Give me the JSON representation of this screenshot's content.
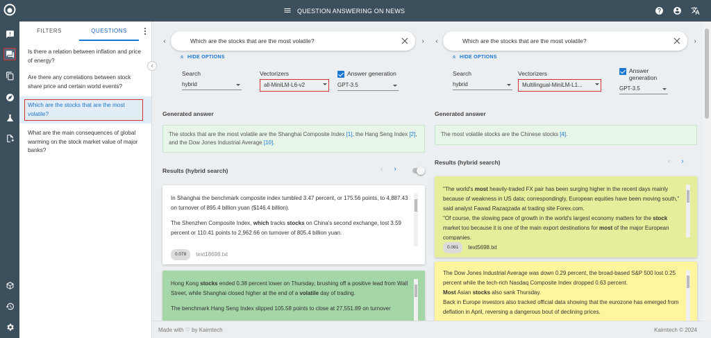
{
  "app": {
    "title": "QUESTION ANSWERING ON NEWS"
  },
  "sidebar": {
    "tabs": [
      {
        "label": "FILTERS"
      },
      {
        "label": "QUESTIONS"
      }
    ],
    "questions": [
      "Is there a relation between inflation and price of energy?",
      "Are there any correlations between stock share price and certain world events?",
      "Which are the stocks that are the most volatile?",
      "What are the main consequences of global warming on the stock market value of major banks?"
    ]
  },
  "left": {
    "query": "Which are the stocks that are the most volatile?",
    "hide_options": "HIDE OPTIONS",
    "search_label": "Search",
    "search_value": "hybrid",
    "vectorizers_label": "Vectorizers",
    "vectorizers_value": "all-MiniLM-L6-v2",
    "answer_gen_label": "Answer generation",
    "answer_gen_value": "GPT-3.5",
    "generated_title": "Generated answer",
    "answer": {
      "t1": "The stocks that are the most volatile are the Shanghai Composite Index ",
      "r1": "[1]",
      "t2": ", the Hang Seng Index ",
      "r2": "[2]",
      "t3": ", and the Dow Jones Industrial Average ",
      "r3": "[10]",
      "t4": "."
    },
    "results_title": "Results (hybrid search)",
    "results": [
      {
        "p1": "In Shanghai the benchmark composite index tumbled 3.47 percent, or 175.56 points, to 4,887.43 on turnover of 895.4 billion yuan ($146.4 billion).",
        "p2a": "The Shenzhen Composite Index, ",
        "p2b": "which",
        "p2c": " tracks ",
        "p2d": "stocks",
        "p2e": " on China's second exchange, lost 3.59 percent or 110.41 points to 2,962.66 on turnover of 805.4 billion yuan.",
        "score": "0.079",
        "file": "text18698.txt"
      },
      {
        "p1a": "Hong Kong ",
        "p1b": "stocks",
        "p1c": " ended 0.38 percent lower on Thursday, brushing off a positive lead from Wall Street, while Shanghai closed higher at the end of a ",
        "p1d": "volatile",
        "p1e": " day of trading.",
        "p2": "The benchmark Hang Seng Index slipped 105.58 points to close at 27,551.89 on turnover"
      }
    ]
  },
  "right": {
    "query": "Which are the stocks that are the most volatile?",
    "hide_options": "HIDE OPTIONS",
    "search_label": "Search",
    "search_value": "hybrid",
    "vectorizers_label": "Vectorizers",
    "vectorizers_value": "Multilingual-MiniLM-L1...",
    "answer_gen_label1": "Answer",
    "answer_gen_label2": "generation",
    "answer_gen_value": "GPT-3.5",
    "generated_title": "Generated answer",
    "answer": {
      "t1": "The most volatile stocks are the Chinese stocks ",
      "r1": "[4]",
      "t2": "."
    },
    "results_title": "Results (hybrid search)",
    "results": [
      {
        "l1a": "\"The world's ",
        "l1b": "most",
        "l1c": " heavily-traded FX pair has been surging higher in the recent days mainly because of weakness in US data; correspondingly, European equities have been moving south,\" said analyst Fawad Razaqzada at trading site Forex.com.",
        "l2a": "\"Of course, the slowing pace of growth in the world's largest economy matters for the ",
        "l2b": "stock",
        "l2c": " market too because it is one of the main export destinations for ",
        "l2d": "most",
        "l2e": " of the major European companies.",
        "score": "0.081",
        "file": "text5698.txt"
      },
      {
        "l1": "The Dow Jones Industrial Average was down 0.29 percent, the broad-based S&P 500 lost 0.25 percent while the tech-rich Nasdaq Composite Index dropped 0.63 percent.",
        "l2a": "Most",
        "l2b": " Asian ",
        "l2c": "stocks",
        "l2d": " also sank Thursday.",
        "l3": "Back in Europe investors also tracked official data showing that the eurozone has emerged from deflation in April, reversing a dangerous bout of declining prices."
      }
    ]
  },
  "footer": {
    "left": "Made with ♡ by Kairntech",
    "right": "Kairntech © 2024"
  }
}
